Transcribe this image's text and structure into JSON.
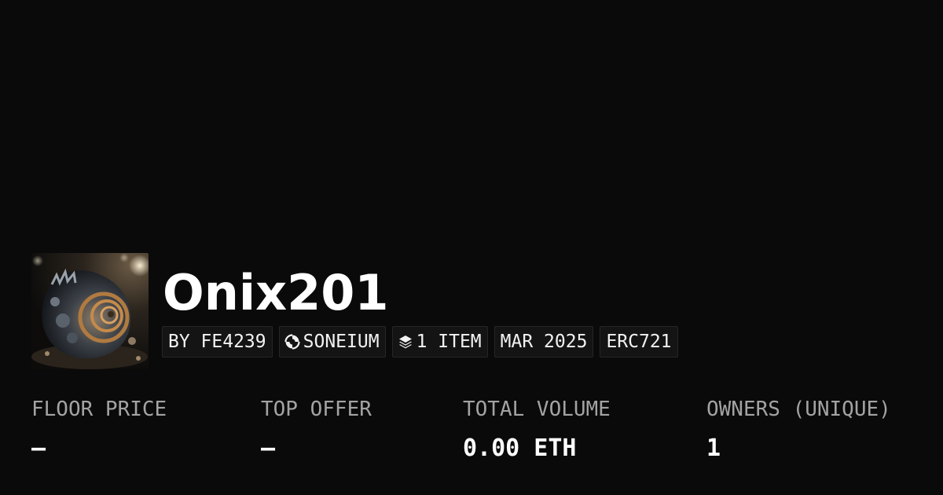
{
  "collection": {
    "name": "Onix201",
    "tags": {
      "creator": "BY FE4239",
      "chain": "SONEIUM",
      "items": "1 ITEM",
      "date": "MAR 2025",
      "standard": "ERC721"
    }
  },
  "stats": [
    {
      "label": "FLOOR PRICE",
      "value": "—"
    },
    {
      "label": "TOP OFFER",
      "value": "—"
    },
    {
      "label": "TOTAL VOLUME",
      "value": "0.00 ETH"
    },
    {
      "label": "OWNERS (UNIQUE)",
      "value": "1"
    }
  ],
  "icons": {
    "chain": "soneium-logo-icon",
    "items": "layers-icon"
  },
  "colors": {
    "background": "#0a0a0a",
    "text": "#ffffff",
    "muted": "#a3a3a3",
    "tag_background": "#141414"
  }
}
